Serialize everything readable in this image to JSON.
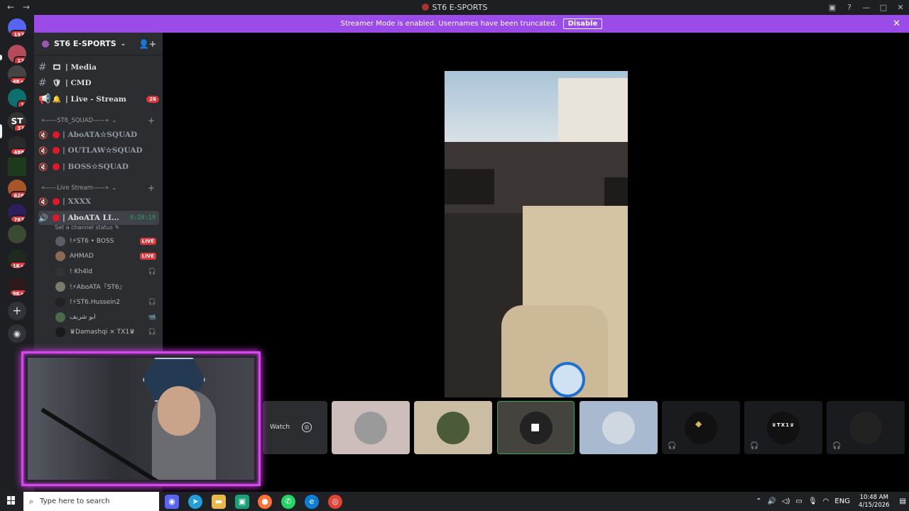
{
  "titlebar": {
    "title": "ST6 E-SPORTS",
    "back": "←",
    "forward": "→"
  },
  "banner": {
    "message": "Streamer Mode is enabled. Usernames have been truncated.",
    "button": "Disable"
  },
  "rail": {
    "badges": [
      "197",
      "12",
      "4K+",
      "1",
      "37",
      "488",
      "626",
      "767",
      "1K+",
      "9K+"
    ]
  },
  "server": {
    "name": "ST6 E-SPORTS"
  },
  "channels": {
    "top": [
      {
        "emoji": "🎞",
        "label": "| Media"
      },
      {
        "emoji": "🛡",
        "label": "| CMD"
      },
      {
        "emoji": "🔔",
        "label": "| Live - Stream",
        "count": "26"
      }
    ],
    "cat1": "«——ST6_SQUAD——»",
    "squad": [
      {
        "label": "| AboATA☆SQUAD"
      },
      {
        "label": "| OUTLAW☆SQUAD"
      },
      {
        "label": "| BOSS☆SQUAD"
      }
    ],
    "cat2": "«——Live Stream——»",
    "live": [
      {
        "label": "| XXXX"
      },
      {
        "label": "| AboATA LI...",
        "timer": "6:28:19"
      }
    ],
    "status_hint": "Set a channel status ✎"
  },
  "users": [
    {
      "name": "!⚡ST6 • BOSS",
      "tag": "LIVE"
    },
    {
      "name": "AHMAD",
      "tag": "LIVE"
    },
    {
      "name": "! Kh4ld",
      "icons": "🎧"
    },
    {
      "name": "!⚡AboATA『ST6』",
      "icons": ""
    },
    {
      "name": "!⚡ST6.Hussein2",
      "icons": "🎧"
    },
    {
      "name": "ابو شريف",
      "icons": "📹"
    },
    {
      "name": "♛Damashqi × TX1♛",
      "icons": "🎧"
    }
  ],
  "voice": {
    "watch_label": "Watch",
    "tile_names": [
      "",
      "",
      "",
      "",
      "",
      "",
      "♛TX1♛",
      ""
    ]
  },
  "taskbar": {
    "search_placeholder": "Type here to search",
    "lang": "ENG",
    "time": "10:48 AM",
    "date": "4/15/2026"
  }
}
